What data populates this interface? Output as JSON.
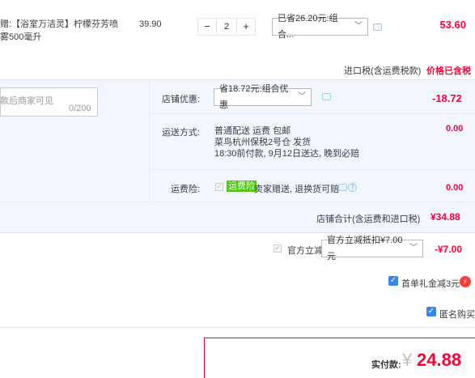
{
  "product": {
    "title_line1": "赠:【浴室万洁灵】柠檬芬芳喷",
    "title_line2": "雾500毫升",
    "price": "39.90",
    "qty_minus": "−",
    "qty_value": "2",
    "qty_plus": "+",
    "discount_select": "已省26.20元:组合...",
    "subtotal": "53.60"
  },
  "tax": {
    "label": "进口税(含运费税款)",
    "note": "价格已含税"
  },
  "message": {
    "placeholder": "款后商家可见",
    "count": "0/200"
  },
  "shop_discount": {
    "label": "店铺优惠:",
    "select": "省18.72元:组合优惠",
    "amount": "-18.72"
  },
  "shipping": {
    "label": "运送方式:",
    "line1": "普通配送 运费 包邮",
    "line2": "菜鸟杭州保税2号仓  发货",
    "line3": "18:30前付款, 9月12日送达, 晚到必赔",
    "amount": "0.00"
  },
  "insurance": {
    "label": "运费险:",
    "check": "✓",
    "badge": "运费险",
    "text": "卖家赠送, 退换货可赔",
    "amount": "0.00"
  },
  "shop_total": {
    "label": "店铺合计(含运费和进口税)",
    "value": "¥34.88"
  },
  "official": {
    "check": "✓",
    "label": "官方立减",
    "select": "官方立减抵扣¥7.00元",
    "amount": "-¥7.00"
  },
  "first_order": {
    "check": "✓",
    "label": "首单礼金减3元",
    "bolt": "⚡"
  },
  "anonymous": {
    "check": "✓",
    "label": "匿名购买"
  },
  "payment": {
    "label": "实付款:",
    "currency": "¥",
    "amount": "24.88"
  },
  "colors": {
    "accent_red": "#ff0036",
    "panel_blue": "#f2f7ff",
    "checkbox_blue": "#3a85e8",
    "badge_green": "#52c41a"
  }
}
